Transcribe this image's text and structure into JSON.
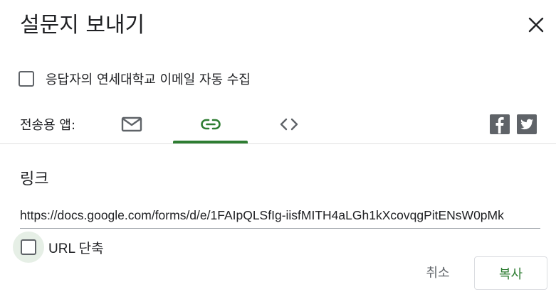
{
  "dialog": {
    "title": "설문지 보내기",
    "close_icon": "close-icon"
  },
  "collect_email": {
    "label": "응답자의 연세대학교 이메일 자동 수집",
    "checked": false
  },
  "send_via": {
    "label": "전송용 앱:",
    "tabs": [
      {
        "icon": "email-icon",
        "selected": false
      },
      {
        "icon": "link-icon",
        "selected": true
      },
      {
        "icon": "embed-code-icon",
        "selected": false
      }
    ],
    "social": [
      {
        "icon": "facebook-icon"
      },
      {
        "icon": "twitter-icon"
      }
    ]
  },
  "link_section": {
    "title": "링크",
    "url": "https://docs.google.com/forms/d/e/1FAIpQLSfIg-iisfMITH4aLGh1kXcovqgPitENsW0pMk",
    "shorten_label": "URL 단축",
    "shorten_checked": false
  },
  "actions": {
    "cancel_label": "취소",
    "copy_label": "복사"
  },
  "colors": {
    "accent": "#2e7d32",
    "icon_gray": "#5f6368",
    "divider": "#e0e0e0"
  }
}
